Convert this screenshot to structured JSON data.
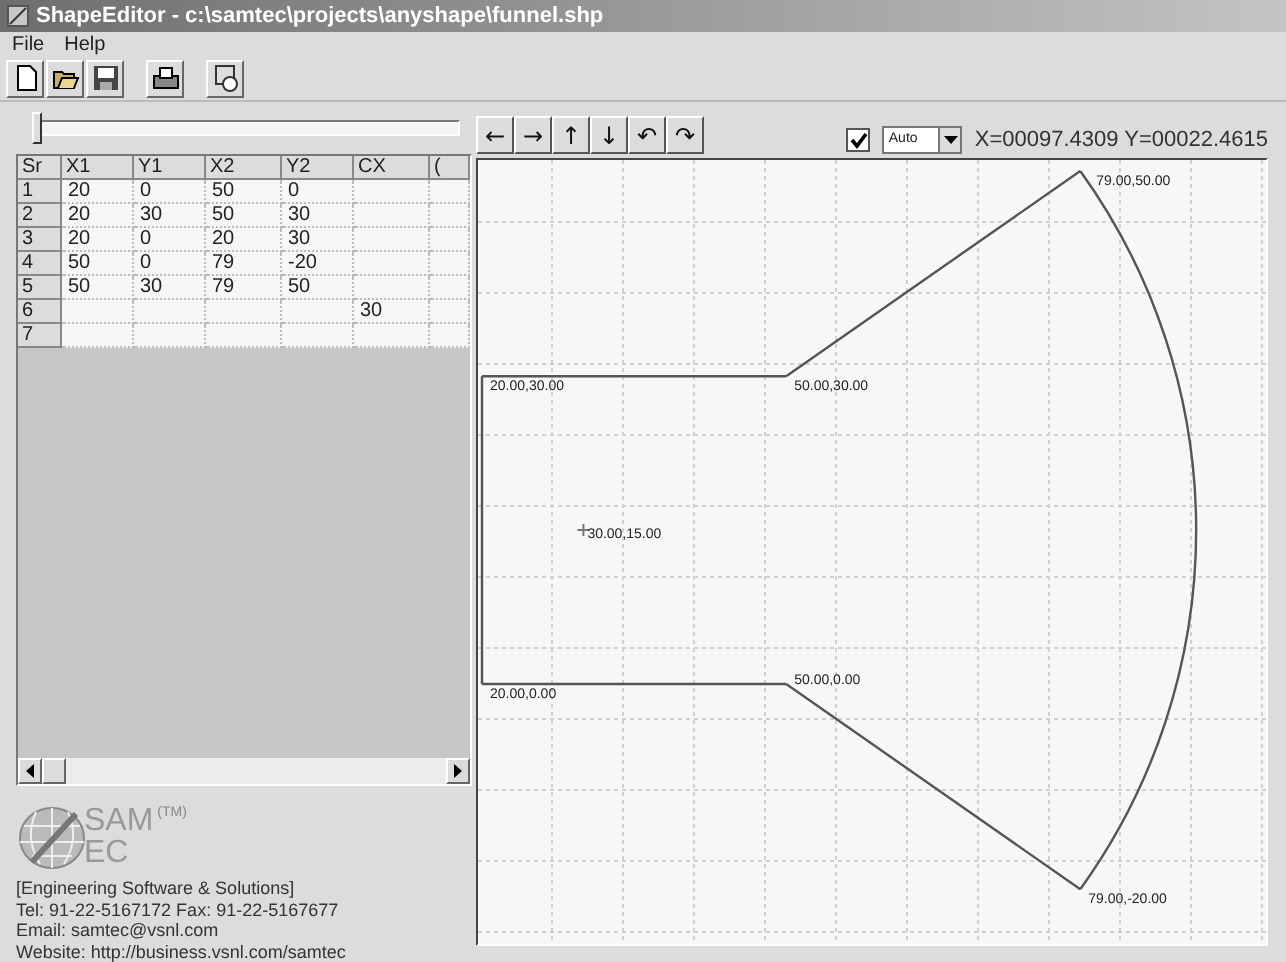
{
  "window": {
    "title": "ShapeEditor - c:\\samtec\\projects\\anyshape\\funnel.shp"
  },
  "menu": [
    "File",
    "Help"
  ],
  "toolbar": [
    {
      "kind": "new"
    },
    {
      "kind": "open"
    },
    {
      "kind": "save"
    },
    {
      "kind": "print"
    },
    {
      "kind": "shape"
    }
  ],
  "slider": {
    "level": 0
  },
  "table": {
    "columns": [
      "Sr",
      "X1",
      "Y1",
      "X2",
      "Y2",
      "CX",
      "("
    ],
    "rows": [
      [
        "1",
        "20",
        "0",
        "50",
        "0",
        "",
        ""
      ],
      [
        "2",
        "20",
        "30",
        "50",
        "30",
        "",
        ""
      ],
      [
        "3",
        "20",
        "0",
        "20",
        "30",
        "",
        ""
      ],
      [
        "4",
        "50",
        "0",
        "79",
        "-20",
        "",
        ""
      ],
      [
        "5",
        "50",
        "30",
        "79",
        "50",
        "",
        ""
      ],
      [
        "6",
        "",
        "",
        "",
        "",
        "30",
        ""
      ],
      [
        "7",
        "",
        "",
        "",
        "",
        "",
        ""
      ]
    ]
  },
  "logo": {
    "name": "SAM",
    "trademark": "(TM)",
    "name_2": "EC"
  },
  "contact": [
    "[Engineering Software & Solutions]",
    "Tel: 91-22-5167172    Fax: 91-22-5167677",
    "Email: samtec@vsnl.com",
    "Website: http://business.vsnl.com/samtec"
  ],
  "nav_buttons": [
    "←",
    "→",
    "↑",
    "↓",
    "↶",
    "↷"
  ],
  "grid_checkbox": {
    "checked": true
  },
  "zoom_dropdown": {
    "value": "Auto"
  },
  "cursor_readout": "X=00097.4309  Y=00022.4615",
  "canvas": {
    "vertices": [
      {
        "label": "79.00,50.00"
      },
      {
        "label": "20.00,30.00"
      },
      {
        "label": "50.00,30.00"
      },
      {
        "label": "20.00,0.00"
      },
      {
        "label": "50.00,0.00"
      },
      {
        "label": "79.00,-20.00"
      }
    ],
    "center": {
      "label": "30.00,15.00"
    }
  }
}
